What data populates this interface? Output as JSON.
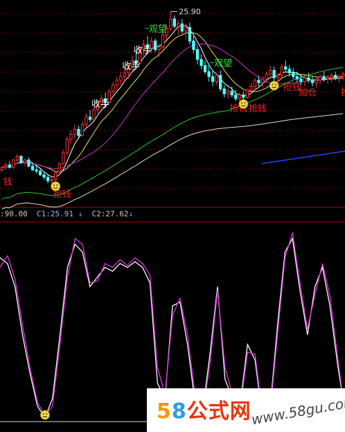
{
  "chart_data": [
    {
      "type": "candlestick",
      "panel": "price",
      "price_high_label": "25.90",
      "annotations": [
        {
          "text": "观望",
          "index": 55
        },
        {
          "text": "观望",
          "index": 38
        },
        {
          "text": "收手",
          "index": 34
        },
        {
          "text": "收手",
          "index": 31
        },
        {
          "text": "收手",
          "index": 23
        },
        {
          "text": "抢钱",
          "index": 13
        },
        {
          "text": "抢钱",
          "index": 59
        },
        {
          "text": "抢钱",
          "index": 64
        },
        {
          "text": "抢钱",
          "index": 73
        },
        {
          "text": "抢钱",
          "index": 88
        },
        {
          "text": "加仓",
          "index": 77
        },
        {
          "text": "钱",
          "index": 0
        }
      ],
      "smiley_indices": [
        14,
        63,
        71
      ],
      "ylim": [
        10,
        26.5
      ],
      "candles": [
        [
          13.0,
          13.3,
          12.8,
          13.2
        ],
        [
          13.2,
          13.6,
          13.0,
          13.4
        ],
        [
          13.4,
          13.7,
          13.1,
          13.2
        ],
        [
          13.2,
          13.9,
          13.1,
          13.8
        ],
        [
          13.8,
          14.3,
          13.6,
          14.1
        ],
        [
          14.1,
          14.2,
          13.5,
          13.6
        ],
        [
          13.6,
          13.9,
          13.3,
          13.8
        ],
        [
          13.8,
          14.0,
          13.2,
          13.3
        ],
        [
          13.3,
          13.5,
          12.9,
          13.0
        ],
        [
          13.0,
          13.4,
          12.7,
          12.9
        ],
        [
          12.9,
          13.1,
          12.5,
          12.6
        ],
        [
          12.6,
          12.9,
          12.2,
          12.4
        ],
        [
          12.4,
          12.6,
          11.9,
          12.1
        ],
        [
          12.1,
          12.4,
          11.8,
          12.2
        ],
        [
          12.2,
          12.9,
          12.0,
          12.8
        ],
        [
          12.8,
          13.6,
          12.7,
          13.5
        ],
        [
          13.5,
          14.6,
          13.4,
          14.4
        ],
        [
          14.4,
          15.7,
          14.2,
          15.5
        ],
        [
          15.5,
          16.2,
          15.1,
          15.9
        ],
        [
          15.9,
          16.7,
          15.5,
          16.3
        ],
        [
          16.3,
          16.6,
          15.6,
          15.8
        ],
        [
          15.8,
          16.9,
          15.7,
          16.7
        ],
        [
          16.7,
          17.6,
          16.4,
          17.3
        ],
        [
          17.3,
          17.9,
          16.9,
          17.1
        ],
        [
          17.1,
          18.1,
          17.0,
          17.9
        ],
        [
          17.9,
          18.6,
          17.6,
          18.3
        ],
        [
          18.3,
          19.1,
          18.0,
          18.8
        ],
        [
          18.8,
          19.3,
          18.2,
          18.5
        ],
        [
          18.5,
          19.6,
          18.4,
          19.4
        ],
        [
          19.4,
          20.2,
          19.1,
          19.9
        ],
        [
          19.9,
          20.6,
          19.5,
          20.3
        ],
        [
          20.3,
          21.0,
          19.9,
          20.6
        ],
        [
          20.6,
          21.3,
          20.2,
          20.9
        ],
        [
          20.9,
          21.6,
          20.4,
          21.2
        ],
        [
          21.2,
          22.3,
          21.0,
          21.9
        ],
        [
          21.9,
          22.6,
          21.4,
          21.7
        ],
        [
          21.7,
          23.0,
          21.6,
          22.8
        ],
        [
          22.8,
          23.6,
          22.3,
          23.2
        ],
        [
          23.2,
          23.9,
          22.6,
          22.9
        ],
        [
          22.9,
          23.8,
          22.5,
          23.5
        ],
        [
          23.5,
          23.7,
          22.6,
          22.8
        ],
        [
          22.8,
          23.3,
          22.2,
          23.0
        ],
        [
          23.0,
          24.2,
          22.8,
          24.0
        ],
        [
          24.0,
          24.8,
          23.6,
          24.5
        ],
        [
          24.5,
          25.9,
          24.3,
          25.3
        ],
        [
          25.3,
          25.6,
          24.5,
          24.7
        ],
        [
          24.7,
          25.2,
          24.0,
          24.9
        ],
        [
          24.9,
          25.3,
          24.1,
          24.3
        ],
        [
          24.3,
          24.9,
          23.6,
          24.6
        ],
        [
          24.6,
          25.0,
          23.2,
          23.5
        ],
        [
          23.5,
          23.9,
          22.5,
          22.8
        ],
        [
          22.8,
          23.1,
          21.6,
          22.0
        ],
        [
          22.0,
          22.4,
          21.2,
          21.5
        ],
        [
          21.5,
          21.9,
          20.8,
          21.0
        ],
        [
          21.0,
          21.6,
          20.2,
          20.6
        ],
        [
          20.6,
          21.1,
          19.8,
          20.2
        ],
        [
          20.2,
          20.9,
          19.9,
          20.7
        ],
        [
          20.7,
          21.1,
          19.4,
          19.6
        ],
        [
          19.6,
          19.9,
          18.9,
          19.2
        ],
        [
          19.2,
          19.6,
          18.8,
          19.4
        ],
        [
          19.4,
          19.8,
          18.9,
          19.1
        ],
        [
          19.1,
          19.5,
          18.6,
          18.8
        ],
        [
          18.8,
          19.3,
          18.5,
          19.1
        ],
        [
          19.1,
          19.4,
          18.7,
          18.9
        ],
        [
          18.9,
          19.6,
          18.8,
          19.5
        ],
        [
          19.5,
          20.1,
          19.2,
          19.8
        ],
        [
          19.8,
          20.5,
          19.5,
          20.3
        ],
        [
          20.3,
          20.7,
          19.8,
          20.1
        ],
        [
          20.1,
          20.6,
          19.7,
          20.4
        ],
        [
          20.4,
          21.0,
          20.1,
          20.8
        ],
        [
          20.8,
          21.5,
          20.6,
          21.1
        ],
        [
          21.1,
          21.4,
          20.2,
          20.5
        ],
        [
          20.5,
          20.9,
          20.0,
          20.7
        ],
        [
          20.7,
          21.6,
          20.5,
          21.4
        ],
        [
          21.4,
          21.9,
          20.9,
          21.2
        ],
        [
          21.2,
          21.5,
          20.6,
          20.9
        ],
        [
          20.9,
          21.3,
          20.4,
          20.6
        ],
        [
          20.6,
          21.0,
          20.1,
          20.4
        ],
        [
          20.4,
          20.8,
          19.9,
          20.2
        ],
        [
          20.2,
          20.7,
          19.8,
          20.5
        ],
        [
          20.5,
          20.9,
          20.1,
          20.3
        ],
        [
          20.3,
          20.6,
          19.8,
          20.1
        ],
        [
          20.1,
          20.5,
          19.7,
          20.3
        ],
        [
          20.3,
          20.8,
          20.0,
          20.6
        ],
        [
          20.6,
          21.0,
          20.2,
          20.4
        ],
        [
          20.4,
          20.7,
          20.0,
          20.5
        ],
        [
          20.5,
          20.9,
          20.1,
          20.7
        ],
        [
          20.7,
          21.0,
          20.3,
          20.5
        ],
        [
          20.5,
          20.8,
          20.1,
          20.6
        ],
        [
          20.6,
          21.0,
          20.3,
          20.8
        ]
      ],
      "series": [
        {
          "name": "ma5",
          "color": "#ffffff"
        },
        {
          "name": "ma10",
          "color": "#e8e860"
        },
        {
          "name": "ma20",
          "color": "#cc33cc"
        },
        {
          "name": "ma60",
          "color": "#22cc22"
        },
        {
          "name": "ma120",
          "color": "#e0e0c0"
        },
        {
          "name": "ma250",
          "color": "#2244ff"
        }
      ]
    },
    {
      "type": "line",
      "panel": "indicator",
      "legend": {
        "prefix": ":90.00",
        "c1_label": "C1:25.91",
        "c2_label": "C2:27.62",
        "arrow": "↓"
      },
      "ylim": [
        0,
        100
      ],
      "series": [
        {
          "name": "K",
          "color": "#ffffff",
          "values": [
            85,
            82,
            70,
            45,
            25,
            8,
            2,
            12,
            45,
            80,
            92,
            88,
            70,
            75,
            80,
            78,
            82,
            80,
            83,
            80,
            72,
            20,
            12,
            60,
            62,
            40,
            10,
            5,
            35,
            70,
            22,
            12,
            8,
            40,
            32,
            2,
            6,
            50,
            88,
            95,
            68,
            45,
            70,
            80,
            60,
            30,
            5
          ]
        },
        {
          "name": "D",
          "color": "#dd33dd",
          "values": [
            80,
            86,
            74,
            50,
            28,
            10,
            3,
            8,
            40,
            75,
            95,
            92,
            72,
            73,
            82,
            80,
            84,
            81,
            85,
            82,
            76,
            28,
            14,
            55,
            64,
            45,
            14,
            4,
            30,
            68,
            28,
            14,
            6,
            36,
            35,
            4,
            4,
            45,
            85,
            98,
            72,
            48,
            66,
            82,
            65,
            34,
            4
          ]
        }
      ]
    }
  ],
  "watermark": {
    "n5": "5",
    "n8": "8",
    "cn": "公式网",
    "url": "www.58gu.com"
  }
}
